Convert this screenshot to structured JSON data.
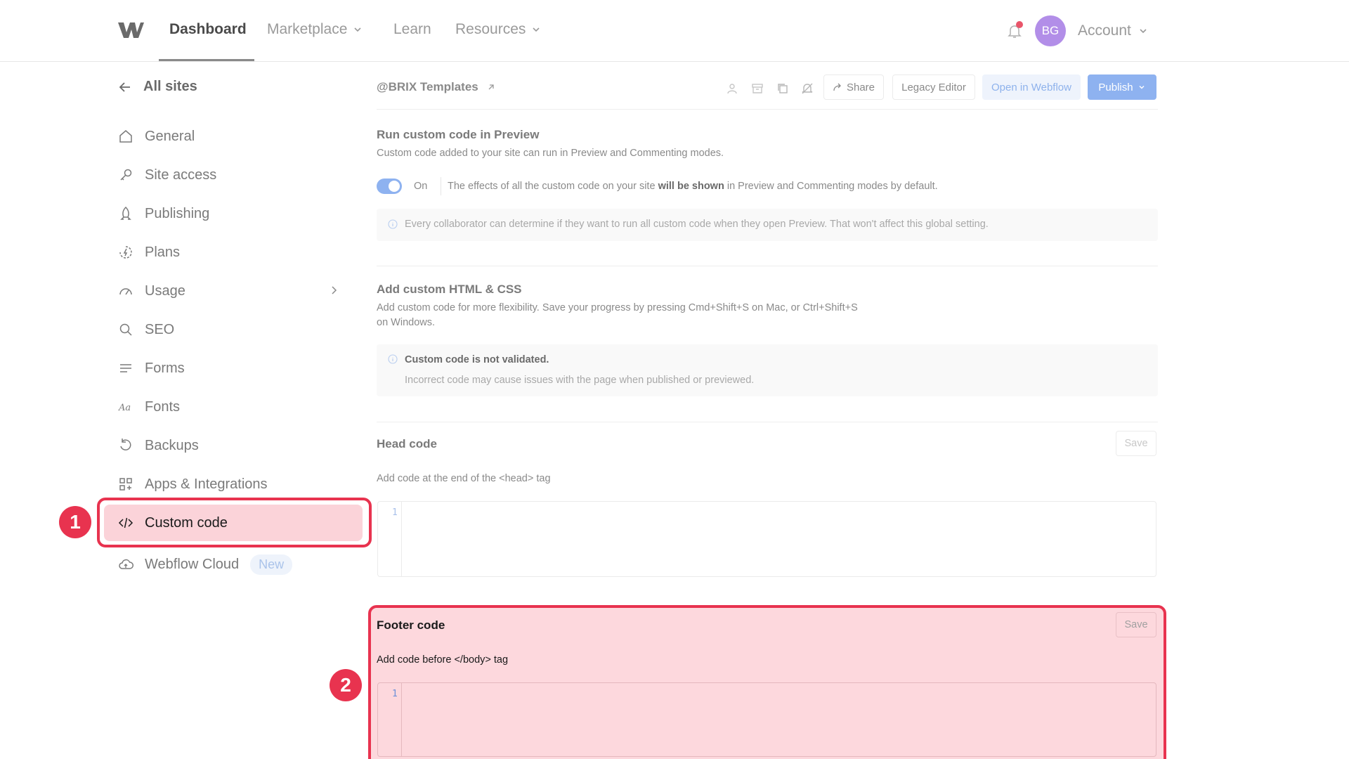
{
  "nav": {
    "items": [
      {
        "label": "Dashboard"
      },
      {
        "label": "Marketplace"
      },
      {
        "label": "Learn"
      },
      {
        "label": "Resources"
      }
    ],
    "avatar_initials": "BG",
    "account_label": "Account"
  },
  "sidebar": {
    "back_label": "All sites",
    "items": [
      {
        "label": "General",
        "icon": "home-icon"
      },
      {
        "label": "Site access",
        "icon": "key-icon"
      },
      {
        "label": "Publishing",
        "icon": "rocket-icon"
      },
      {
        "label": "Plans",
        "icon": "plan-icon"
      },
      {
        "label": "Usage",
        "icon": "gauge-icon"
      },
      {
        "label": "SEO",
        "icon": "search-icon"
      },
      {
        "label": "Forms",
        "icon": "forms-icon"
      },
      {
        "label": "Fonts",
        "icon": "font-icon"
      },
      {
        "label": "Backups",
        "icon": "backup-icon"
      },
      {
        "label": "Apps & Integrations",
        "icon": "apps-icon"
      },
      {
        "label": "Custom code",
        "icon": "code-icon"
      },
      {
        "label": "Webflow Cloud",
        "icon": "cloud-icon",
        "badge": "New"
      }
    ]
  },
  "steps": [
    "1",
    "2"
  ],
  "header": {
    "site_name": "@BRIX Templates",
    "share": "Share",
    "legacy_editor": "Legacy Editor",
    "open_in_webflow": "Open in Webflow",
    "publish": "Publish"
  },
  "preview": {
    "title": "Run custom code in Preview",
    "desc": "Custom code added to your site can run in Preview and Commenting modes.",
    "toggle_label": "On",
    "toggle_desc_a": "The effects of all the custom code on your site ",
    "toggle_desc_bold": "will be shown",
    "toggle_desc_b": " in Preview and Commenting modes by default.",
    "info": "Every collaborator can determine if they want to run all custom code when they open Preview. That won't affect this global setting."
  },
  "custom_html": {
    "title": "Add custom HTML & CSS",
    "desc_line1": "Add custom code for more flexibility. Save your progress by pressing Cmd+Shift+S on Mac, or Ctrl+Shift+S",
    "desc_line2": "on Windows.",
    "warn_title": "Custom code is not validated.",
    "warn_desc": "Incorrect code may cause issues with the page when published or previewed."
  },
  "head_code": {
    "title": "Head code",
    "save": "Save",
    "desc": "Add code at the end of the <head> tag",
    "line": "1"
  },
  "footer_code": {
    "title": "Footer code",
    "save": "Save",
    "desc": "Add code before </body> tag",
    "line": "1"
  }
}
